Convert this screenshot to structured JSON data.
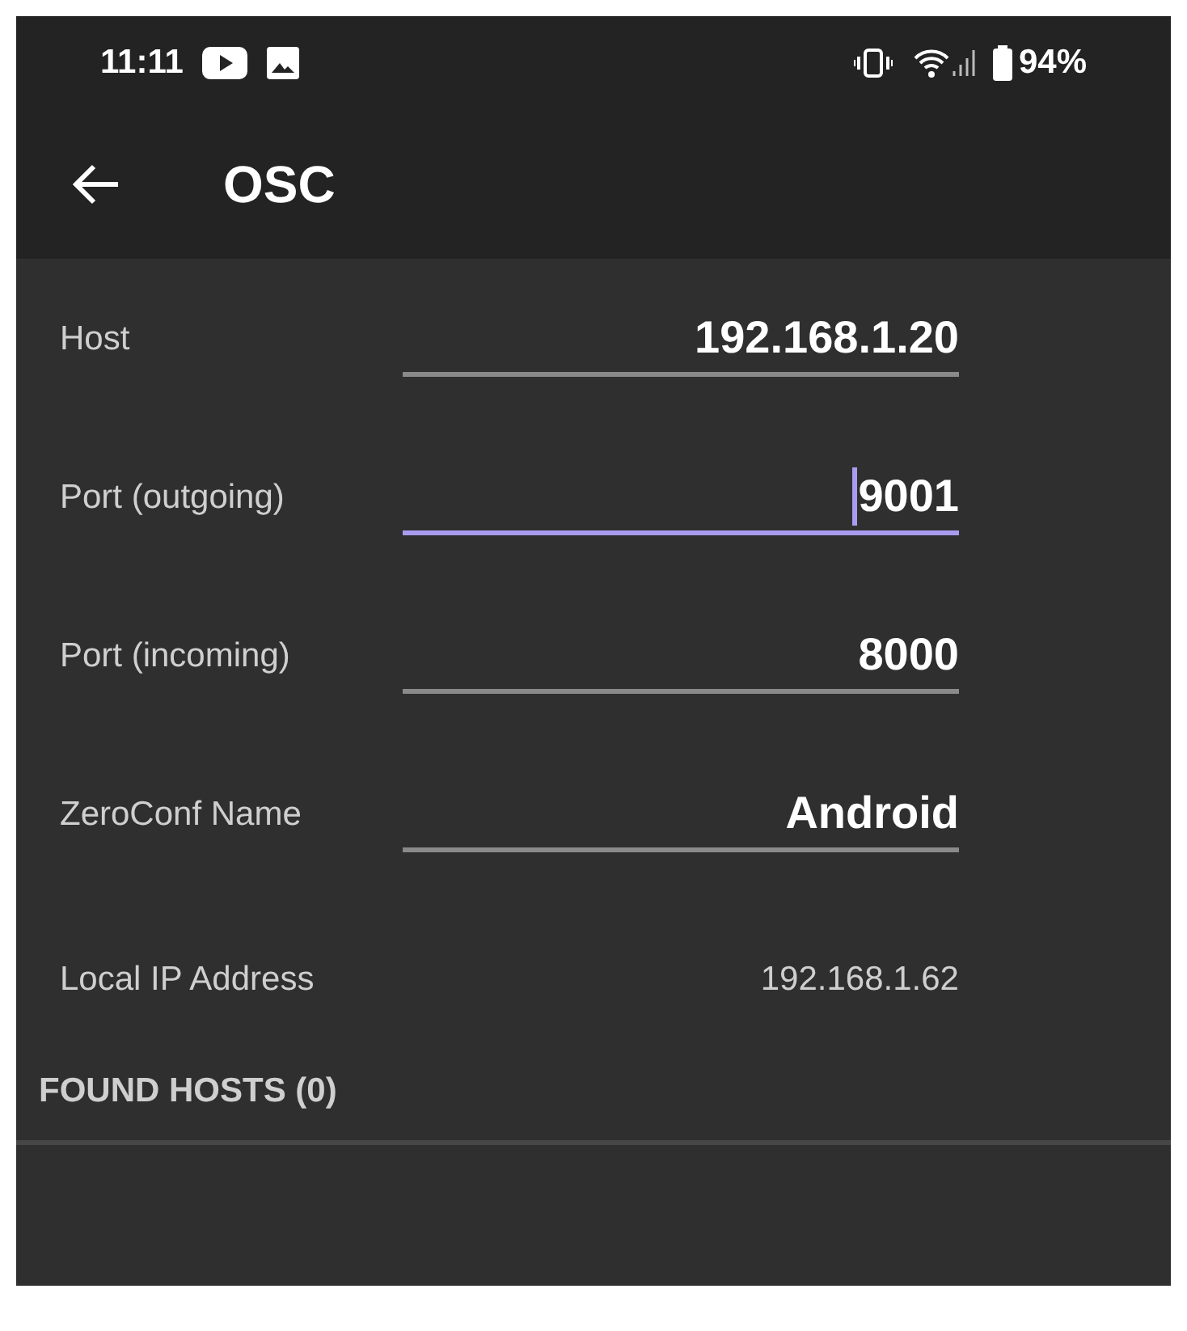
{
  "status_bar": {
    "time": "11:11",
    "battery": "94%"
  },
  "app_bar": {
    "title": "OSC"
  },
  "settings": [
    {
      "kind": "input",
      "label": "Host",
      "value": "192.168.1.20",
      "focused": false
    },
    {
      "kind": "input",
      "label": "Port (outgoing)",
      "value": "9001",
      "focused": true
    },
    {
      "kind": "input",
      "label": "Port (incoming)",
      "value": "8000",
      "focused": false
    },
    {
      "kind": "input",
      "label": "ZeroConf Name",
      "value": "Android",
      "focused": false
    },
    {
      "kind": "readonly",
      "label": "Local IP Address",
      "value": "192.168.1.62"
    }
  ],
  "found_hosts": {
    "header": "FOUND HOSTS (0)"
  }
}
